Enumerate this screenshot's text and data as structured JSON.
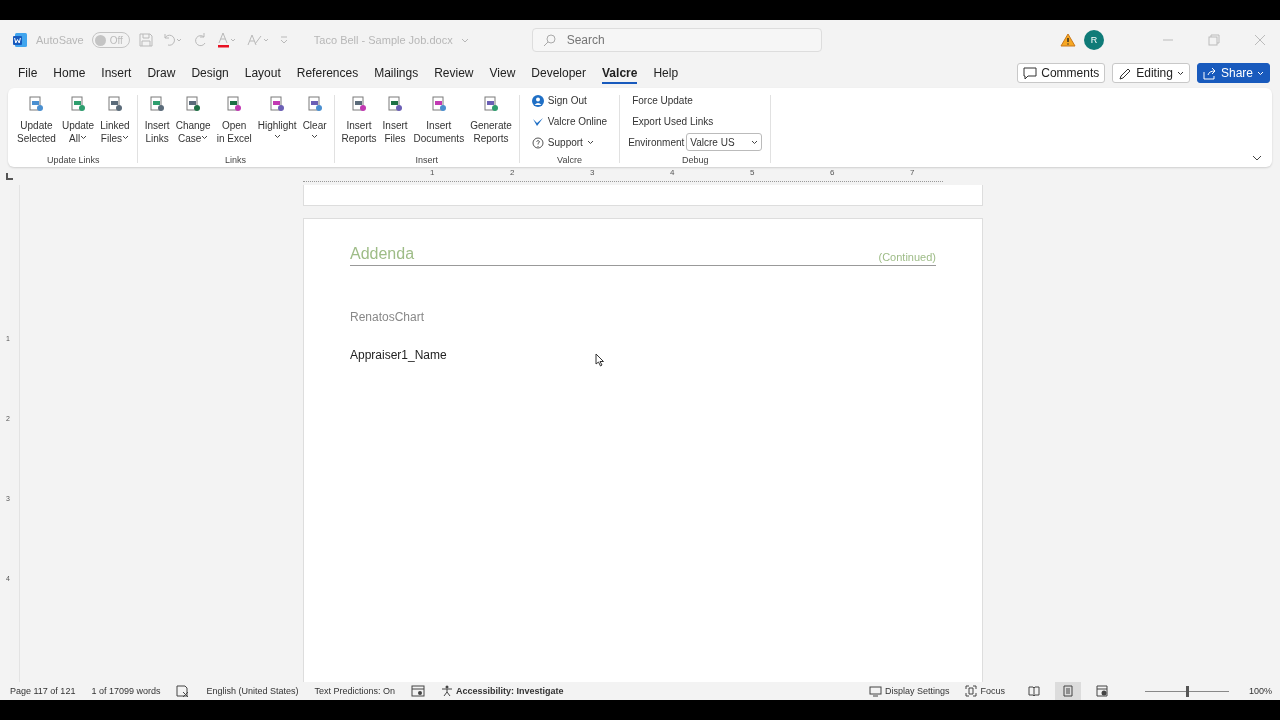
{
  "title_bar": {
    "autosave_label": "AutoSave",
    "autosave": {
      "on": false,
      "label": "Off"
    },
    "document_title": "Taco Bell - Sample Job.docx",
    "search": {
      "placeholder": "Search"
    },
    "avatar": "R"
  },
  "tabs": [
    {
      "label": "File",
      "selected": false
    },
    {
      "label": "Home",
      "selected": false
    },
    {
      "label": "Insert",
      "selected": false
    },
    {
      "label": "Draw",
      "selected": false
    },
    {
      "label": "Design",
      "selected": false
    },
    {
      "label": "Layout",
      "selected": false
    },
    {
      "label": "References",
      "selected": false
    },
    {
      "label": "Mailings",
      "selected": false
    },
    {
      "label": "Review",
      "selected": false
    },
    {
      "label": "View",
      "selected": false
    },
    {
      "label": "Developer",
      "selected": false
    },
    {
      "label": "Valcre",
      "selected": true
    },
    {
      "label": "Help",
      "selected": false
    }
  ],
  "actions": [
    {
      "label": "Comments",
      "kind": "comments"
    },
    {
      "label": "Editing",
      "kind": "editing"
    },
    {
      "label": "Share",
      "kind": "share"
    }
  ],
  "ribbon": [
    {
      "label": "Update Links",
      "items": [
        {
          "kind": "large",
          "lines": [
            "Update",
            "Selected"
          ],
          "caret": false
        },
        {
          "kind": "large",
          "lines": [
            "Update",
            "All"
          ],
          "caret": true
        },
        {
          "kind": "large",
          "lines": [
            "Linked",
            "Files"
          ],
          "caret": true
        }
      ]
    },
    {
      "label": "Links",
      "items": [
        {
          "kind": "large",
          "lines": [
            "Insert",
            "Links"
          ],
          "caret": false
        },
        {
          "kind": "large",
          "lines": [
            "Change",
            "Case"
          ],
          "caret": true
        },
        {
          "kind": "large",
          "lines": [
            "Open",
            "in Excel"
          ],
          "caret": false
        },
        {
          "kind": "large",
          "lines": [
            "Highlight"
          ],
          "caret": true
        },
        {
          "kind": "large",
          "lines": [
            "Clear"
          ],
          "caret": true
        }
      ]
    },
    {
      "label": "Insert",
      "items": [
        {
          "kind": "large",
          "lines": [
            "Insert",
            "Reports"
          ],
          "caret": false
        },
        {
          "kind": "large",
          "lines": [
            "Insert",
            "Files"
          ],
          "caret": false
        },
        {
          "kind": "large",
          "lines": [
            "Insert",
            "Documents"
          ],
          "caret": false
        },
        {
          "kind": "large",
          "lines": [
            "Generate",
            "Reports"
          ],
          "caret": false
        }
      ]
    },
    {
      "label": "Valcre",
      "items": [
        {
          "kind": "small",
          "lines": [
            "Sign Out"
          ],
          "caret": false
        },
        {
          "kind": "small",
          "lines": [
            "Valcre Online"
          ],
          "caret": false
        },
        {
          "kind": "small",
          "lines": [
            "Support"
          ],
          "caret": true
        }
      ]
    },
    {
      "label": "Debug",
      "items": [
        {
          "kind": "text",
          "lines": [
            "Force Update"
          ]
        },
        {
          "kind": "text",
          "lines": [
            "Export Used Links"
          ]
        },
        {
          "kind": "select",
          "lines": [
            "Environment"
          ],
          "value": "Valcre US"
        }
      ]
    }
  ],
  "ruler": {
    "labels": [
      "1",
      "2",
      "3",
      "4",
      "5",
      "6",
      "7"
    ]
  },
  "vertical_ruler": {
    "labels": [
      "1",
      "2",
      "3",
      "4"
    ]
  },
  "document": {
    "heading": "Addenda",
    "heading_note": "(Continued)",
    "lines": [
      {
        "text": "RenatosChart",
        "kind": "muted"
      },
      {
        "text": "Appraiser1_Name",
        "kind": "normal"
      }
    ]
  },
  "status_bar": {
    "left": [
      {
        "text": "Page 117 of 121",
        "kind": "text"
      },
      {
        "text": "1 of 17099 words",
        "kind": "text"
      },
      {
        "kind": "proofing"
      },
      {
        "text": "English (United States)",
        "kind": "text"
      },
      {
        "text": "Text Predictions: On",
        "kind": "text"
      },
      {
        "kind": "macro"
      },
      {
        "text": "Accessibility: Investigate",
        "kind": "accessibility"
      }
    ],
    "display_settings": "Display Settings",
    "focus": "Focus",
    "views": [
      {
        "kind": "read",
        "selected": false
      },
      {
        "kind": "print",
        "selected": true
      },
      {
        "kind": "web",
        "selected": false
      }
    ],
    "zoom": {
      "level": 0.5,
      "label": "100%"
    }
  }
}
